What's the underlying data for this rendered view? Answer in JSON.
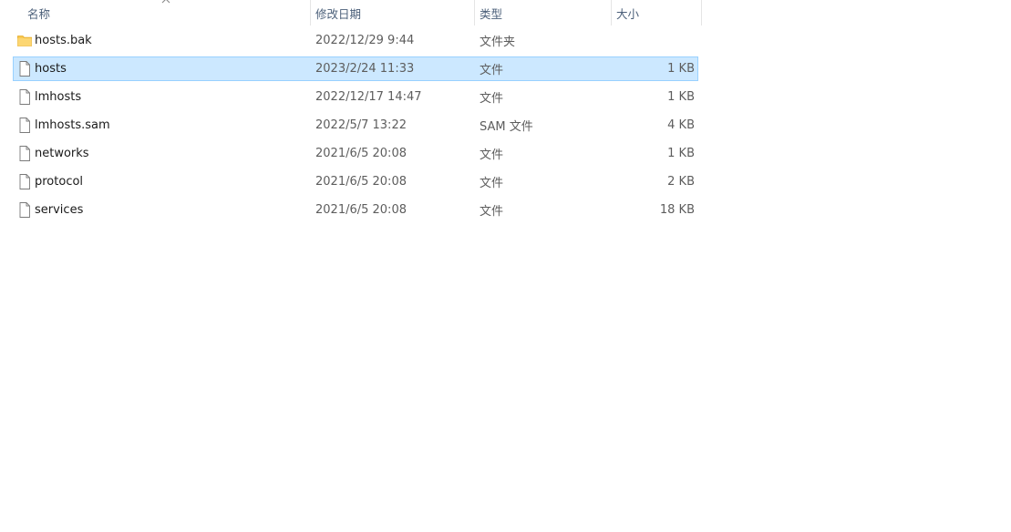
{
  "columns": {
    "name": "名称",
    "modified": "修改日期",
    "type": "类型",
    "size": "大小"
  },
  "files": [
    {
      "name": "hosts.bak",
      "modified": "2022/12/29 9:44",
      "type": "文件夹",
      "size": "",
      "icon": "folder-icon",
      "selected": false
    },
    {
      "name": "hosts",
      "modified": "2023/2/24 11:33",
      "type": "文件",
      "size": "1 KB",
      "icon": "file-icon",
      "selected": true
    },
    {
      "name": "lmhosts",
      "modified": "2022/12/17 14:47",
      "type": "文件",
      "size": "1 KB",
      "icon": "file-icon",
      "selected": false
    },
    {
      "name": "lmhosts.sam",
      "modified": "2022/5/7 13:22",
      "type": "SAM 文件",
      "size": "4 KB",
      "icon": "file-icon",
      "selected": false
    },
    {
      "name": "networks",
      "modified": "2021/6/5 20:08",
      "type": "文件",
      "size": "1 KB",
      "icon": "file-icon",
      "selected": false
    },
    {
      "name": "protocol",
      "modified": "2021/6/5 20:08",
      "type": "文件",
      "size": "2 KB",
      "icon": "file-icon",
      "selected": false
    },
    {
      "name": "services",
      "modified": "2021/6/5 20:08",
      "type": "文件",
      "size": "18 KB",
      "icon": "file-icon",
      "selected": false
    }
  ],
  "colors": {
    "selection_bg": "#cce8ff",
    "selection_border": "#99d1ff",
    "header_text": "#4c607a",
    "folder": "#f8c851"
  }
}
